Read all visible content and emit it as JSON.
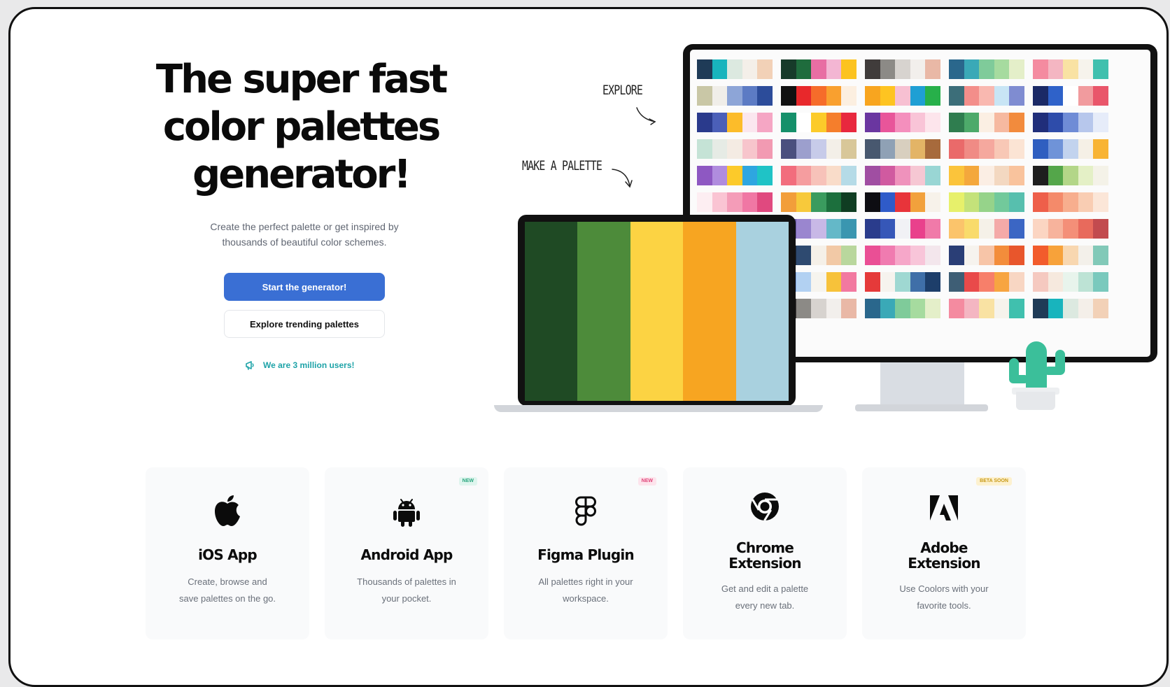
{
  "hero": {
    "title_lines": [
      "The super fast",
      "color palettes",
      "generator!"
    ],
    "subtitle_lines": [
      "Create the perfect palette or get inspired by",
      "thousands of beautiful color schemes."
    ],
    "primary_button": "Start the generator!",
    "secondary_button": "Explore trending palettes",
    "users_note": "We are 3 million users!"
  },
  "illustration": {
    "label_explore": "EXPLORE",
    "label_make": "MAKE A PALETTE",
    "laptop_palette": [
      "#1f4a24",
      "#4d8b3a",
      "#fcd343",
      "#f7a521",
      "#a9d1df"
    ],
    "monitor_palettes": [
      [
        [
          "#1f3b57",
          "#18b4bd",
          "#dce9e0",
          "#f4efe9",
          "#f2d1b7"
        ],
        [
          "#173b2a",
          "#1f6c3d",
          "#e86ea3",
          "#f3b6d3",
          "#fcc31f"
        ],
        [
          "#403c3b",
          "#8c8a86",
          "#d7d3cf",
          "#f2efec",
          "#e9b8a6"
        ],
        [
          "#2a678c",
          "#3aa9b7",
          "#7fcb9a",
          "#a6db9f",
          "#e4efc9"
        ],
        [
          "#f48ba0",
          "#f4b6c2",
          "#f9e2a3",
          "#f6f3ec",
          "#40c0ae"
        ]
      ],
      [
        [
          "#c9c7a6",
          "#f0eee9",
          "#8da5d7",
          "#5c7bc4",
          "#2c4c9a"
        ],
        [
          "#111111",
          "#e8282b",
          "#f66c2a",
          "#f9a02f",
          "#fcefe0"
        ],
        [
          "#f8a51f",
          "#fec421",
          "#f7c0d2",
          "#1f9fd4",
          "#27b04a"
        ],
        [
          "#3c6e79",
          "#f38e8a",
          "#f9b8b0",
          "#c8e5f5",
          "#7f8cd1"
        ],
        [
          "#1b2a66",
          "#2f62c9",
          "#ffffff",
          "#f19b9e",
          "#e9566a"
        ]
      ],
      [
        [
          "#2a3a8c",
          "#4b5fb8",
          "#fcbc2a",
          "#fbe7ef",
          "#f5a6c4"
        ],
        [
          "#15906a",
          "#ffffff",
          "#fccb2a",
          "#f57e2c",
          "#e8283e"
        ],
        [
          "#6a36a0",
          "#e8559a",
          "#f48fbd",
          "#f9c4d7",
          "#fde5ec"
        ],
        [
          "#2f7d4f",
          "#4daa6a",
          "#fbefe3",
          "#f6b9a0",
          "#f28b3d"
        ],
        [
          "#202e7a",
          "#2e4caa",
          "#6f8cd6",
          "#b7c7ec",
          "#e6ecf9"
        ]
      ],
      [
        [
          "#c5e3d6",
          "#e6ebe5",
          "#f4ebe3",
          "#f7c5cc",
          "#f29ab2"
        ],
        [
          "#4a4f7e",
          "#9c9fcd",
          "#c7cbe9",
          "#f3efe8",
          "#d8c799"
        ],
        [
          "#48586f",
          "#8fa1b5",
          "#d8cfbf",
          "#e3b466",
          "#a76a3c"
        ],
        [
          "#ea6a6a",
          "#f08b85",
          "#f5a89e",
          "#f8c8b6",
          "#fbe4d4"
        ],
        [
          "#2f5fc0",
          "#6f93d8",
          "#c2d3ee",
          "#f5f0e6",
          "#f8b434"
        ]
      ],
      [
        [
          "#8e58c2",
          "#b08cde",
          "#fcca2a",
          "#2ea6e0",
          "#1fc3c6"
        ],
        [
          "#f26d7d",
          "#f59d9f",
          "#f7c2b9",
          "#f9dcc9",
          "#b5dbe7"
        ],
        [
          "#a04ea2",
          "#d05aa0",
          "#ef92bc",
          "#f6c7d3",
          "#99d6d4"
        ],
        [
          "#fbc43b",
          "#f4a83c",
          "#fbeee4",
          "#f3d8c1",
          "#f9c39d"
        ],
        [
          "#1e1e1e",
          "#54a64a",
          "#b3d688",
          "#e4f0c6",
          "#f4f2e8"
        ]
      ],
      [
        [
          "#fdeef2",
          "#fac4d3",
          "#f49cb8",
          "#f077a4",
          "#e0497f"
        ],
        [
          "#f29e3a",
          "#f7c93b",
          "#3a9b5e",
          "#1c6f3d",
          "#0f3d22"
        ],
        [
          "#0d0d12",
          "#2f5bc9",
          "#e8343a",
          "#f2a13c",
          "#f7f2ea"
        ],
        [
          "#e7f06b",
          "#c4e27a",
          "#96d38a",
          "#72c99b",
          "#57bfae"
        ],
        [
          "#ee5f4a",
          "#f48a6a",
          "#f7ae8e",
          "#f9cdb3",
          "#fbe6d8"
        ]
      ],
      [
        [
          "#2c5a9b",
          "#3f88d9",
          "#fcd33b",
          "#f6f4ee",
          "#f4a7b0"
        ],
        [
          "#6a5aa8",
          "#9a86cf",
          "#c8b8e6",
          "#64b8c8",
          "#3a96b0"
        ],
        [
          "#2a3c8c",
          "#3657b8",
          "#f1f1f5",
          "#e9418c",
          "#f07aa9"
        ],
        [
          "#fbc46b",
          "#f9db6b",
          "#f5f1e8",
          "#f4aaa8",
          "#3b66c4"
        ],
        [
          "#fbd5c2",
          "#f7b39c",
          "#f48f78",
          "#e86a5c",
          "#c24b4f"
        ]
      ],
      [
        [
          "#2b6f8f",
          "#c79b74",
          "#f3dccb",
          "#fbefe3",
          "#b59bd6"
        ],
        [
          "#1b2a40",
          "#2e4a70",
          "#f5f0e8",
          "#f2c9a6",
          "#b9d79d"
        ],
        [
          "#ea4f95",
          "#f07bb0",
          "#f6a7c9",
          "#f8c5d9",
          "#f3e6ec"
        ],
        [
          "#2a3e76",
          "#f6f3ee",
          "#f7c5a8",
          "#f38d3b",
          "#e8562c"
        ],
        [
          "#f25c2c",
          "#f7a23a",
          "#f8d7b0",
          "#f3f0ea",
          "#82c9b8"
        ]
      ],
      [
        [
          "#2a7a9a",
          "#43a3c0",
          "#f3f0ea",
          "#f9d6b0",
          "#f7a23a"
        ],
        [
          "#7fa7e8",
          "#b2d1f2",
          "#f6f4ee",
          "#f7c23a",
          "#f279a0"
        ],
        [
          "#e53a3a",
          "#f6f3ee",
          "#9fd8d2",
          "#3f6fa8",
          "#1d3e6a"
        ],
        [
          "#3e5e75",
          "#e94a4a",
          "#f77f6a",
          "#f7a541",
          "#f8d6c3"
        ],
        [
          "#f5c9c0",
          "#f6e9de",
          "#e8f4ec",
          "#bde3d5",
          "#7ac9bd"
        ]
      ],
      [
        [
          "#1d6b3e",
          "#38a35c",
          "#e86ea3",
          "#f3b6d3",
          "#fcc31f"
        ],
        [
          "#403c3b",
          "#8c8a86",
          "#d7d3cf",
          "#f2efec",
          "#e9b8a6"
        ],
        [
          "#2a678c",
          "#3aa9b7",
          "#7fcb9a",
          "#a6db9f",
          "#e4efc9"
        ],
        [
          "#f48ba0",
          "#f4b6c2",
          "#f9e2a3",
          "#f6f3ec",
          "#40c0ae"
        ],
        [
          "#1f3b57",
          "#18b4bd",
          "#dce9e0",
          "#f4efe9",
          "#f2d1b7"
        ]
      ]
    ]
  },
  "cards": [
    {
      "title_lines": [
        "iOS App"
      ],
      "desc_lines": [
        "Create, browse and",
        "save palettes on the go."
      ],
      "badge": "",
      "icon": "apple-icon"
    },
    {
      "title_lines": [
        "Android App"
      ],
      "desc_lines": [
        "Thousands of palettes in",
        "your pocket."
      ],
      "badge": "NEW",
      "badge_bg": "#dff5ee",
      "badge_fg": "#2aa67e",
      "icon": "android-icon"
    },
    {
      "title_lines": [
        "Figma Plugin"
      ],
      "desc_lines": [
        "All palettes right in your",
        "workspace."
      ],
      "badge": "NEW",
      "badge_bg": "#fde4ec",
      "badge_fg": "#e0457a",
      "icon": "figma-icon"
    },
    {
      "title_lines": [
        "Chrome",
        "Extension"
      ],
      "desc_lines": [
        "Get and edit a palette",
        "every new tab."
      ],
      "badge": "",
      "icon": "chrome-icon"
    },
    {
      "title_lines": [
        "Adobe",
        "Extension"
      ],
      "desc_lines": [
        "Use Coolors with your",
        "favorite tools."
      ],
      "badge": "BETA SOON",
      "badge_bg": "#fdf1cf",
      "badge_fg": "#c89a16",
      "icon": "adobe-icon"
    }
  ]
}
